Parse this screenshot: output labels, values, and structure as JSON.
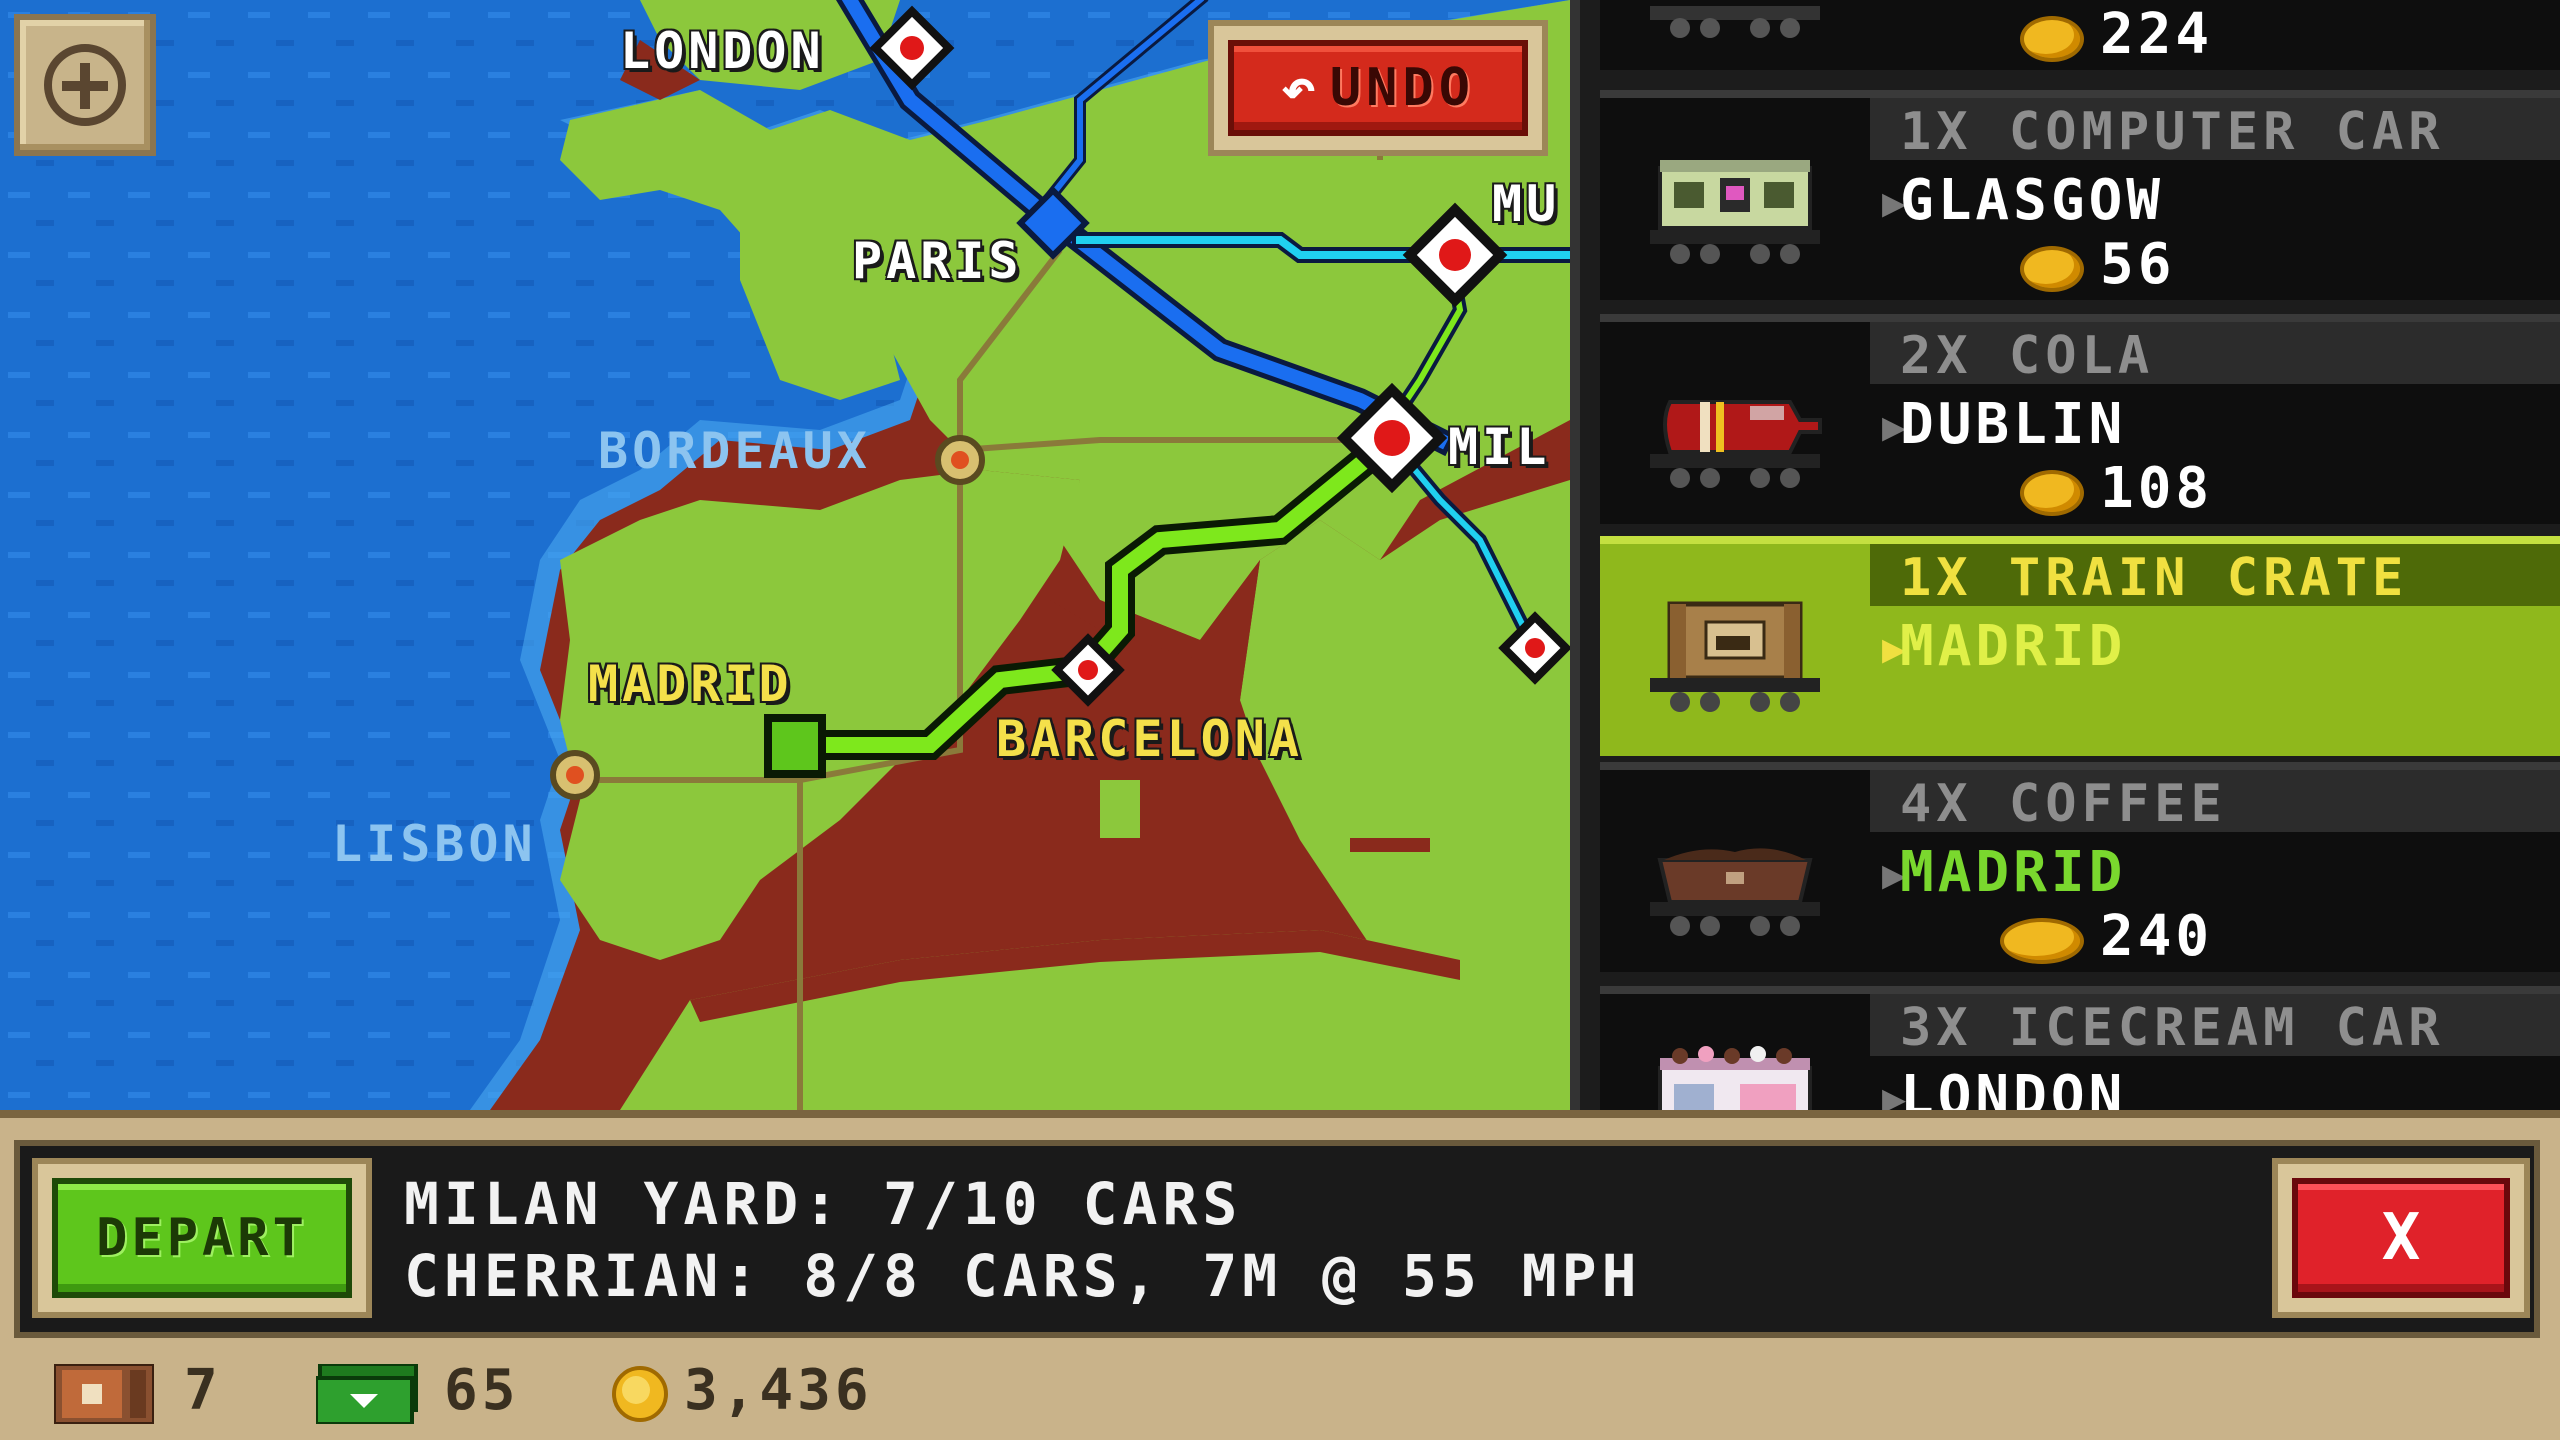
{
  "map": {
    "cities": {
      "london": "LONDON",
      "paris": "PARIS",
      "milan_partial": "MIL",
      "munich_partial": "MU",
      "bordeaux": "BORDEAUX",
      "madrid": "MADRID",
      "barcelona": "BARCELONA",
      "lisbon": "LISBON"
    },
    "undo_label": "UNDO",
    "zoom_icon": "zoom-in-icon"
  },
  "cargo_list": [
    {
      "qty": "",
      "destination": "",
      "reward": "224",
      "icon": "car-icon",
      "selected": false
    },
    {
      "qty": "1X COMPUTER CAR",
      "destination": "GLASGOW",
      "reward": "56",
      "icon": "computer-car-icon",
      "selected": false
    },
    {
      "qty": "2X COLA",
      "destination": "DUBLIN",
      "reward": "108",
      "icon": "cola-car-icon",
      "selected": false
    },
    {
      "qty": "1X TRAIN CRATE",
      "destination": "MADRID",
      "reward": "",
      "icon": "train-crate-icon",
      "selected": true
    },
    {
      "qty": "4X COFFEE",
      "destination": "MADRID",
      "reward": "240",
      "icon": "coffee-car-icon",
      "selected": false
    },
    {
      "qty": "3X ICECREAM CAR",
      "destination": "LONDON",
      "reward": "",
      "icon": "icecream-car-icon",
      "selected": false
    }
  ],
  "bottom": {
    "depart_label": "DEPART",
    "yard_line": "MILAN YARD: 7/10 CARS",
    "train_line": "CHERRIAN: 8/8 CARS, 7M @ 55 MPH",
    "close_label": "X"
  },
  "stats": {
    "crates": "7",
    "cash": "65",
    "coins": "3,436"
  },
  "colors": {
    "sea": "#1c6fd0",
    "land": "#8cc83c",
    "route_selected": "#7ee81c",
    "route_blue": "#1a6ef0",
    "route_cyan": "#20d0f0",
    "selected_row": "#8fb81c"
  }
}
